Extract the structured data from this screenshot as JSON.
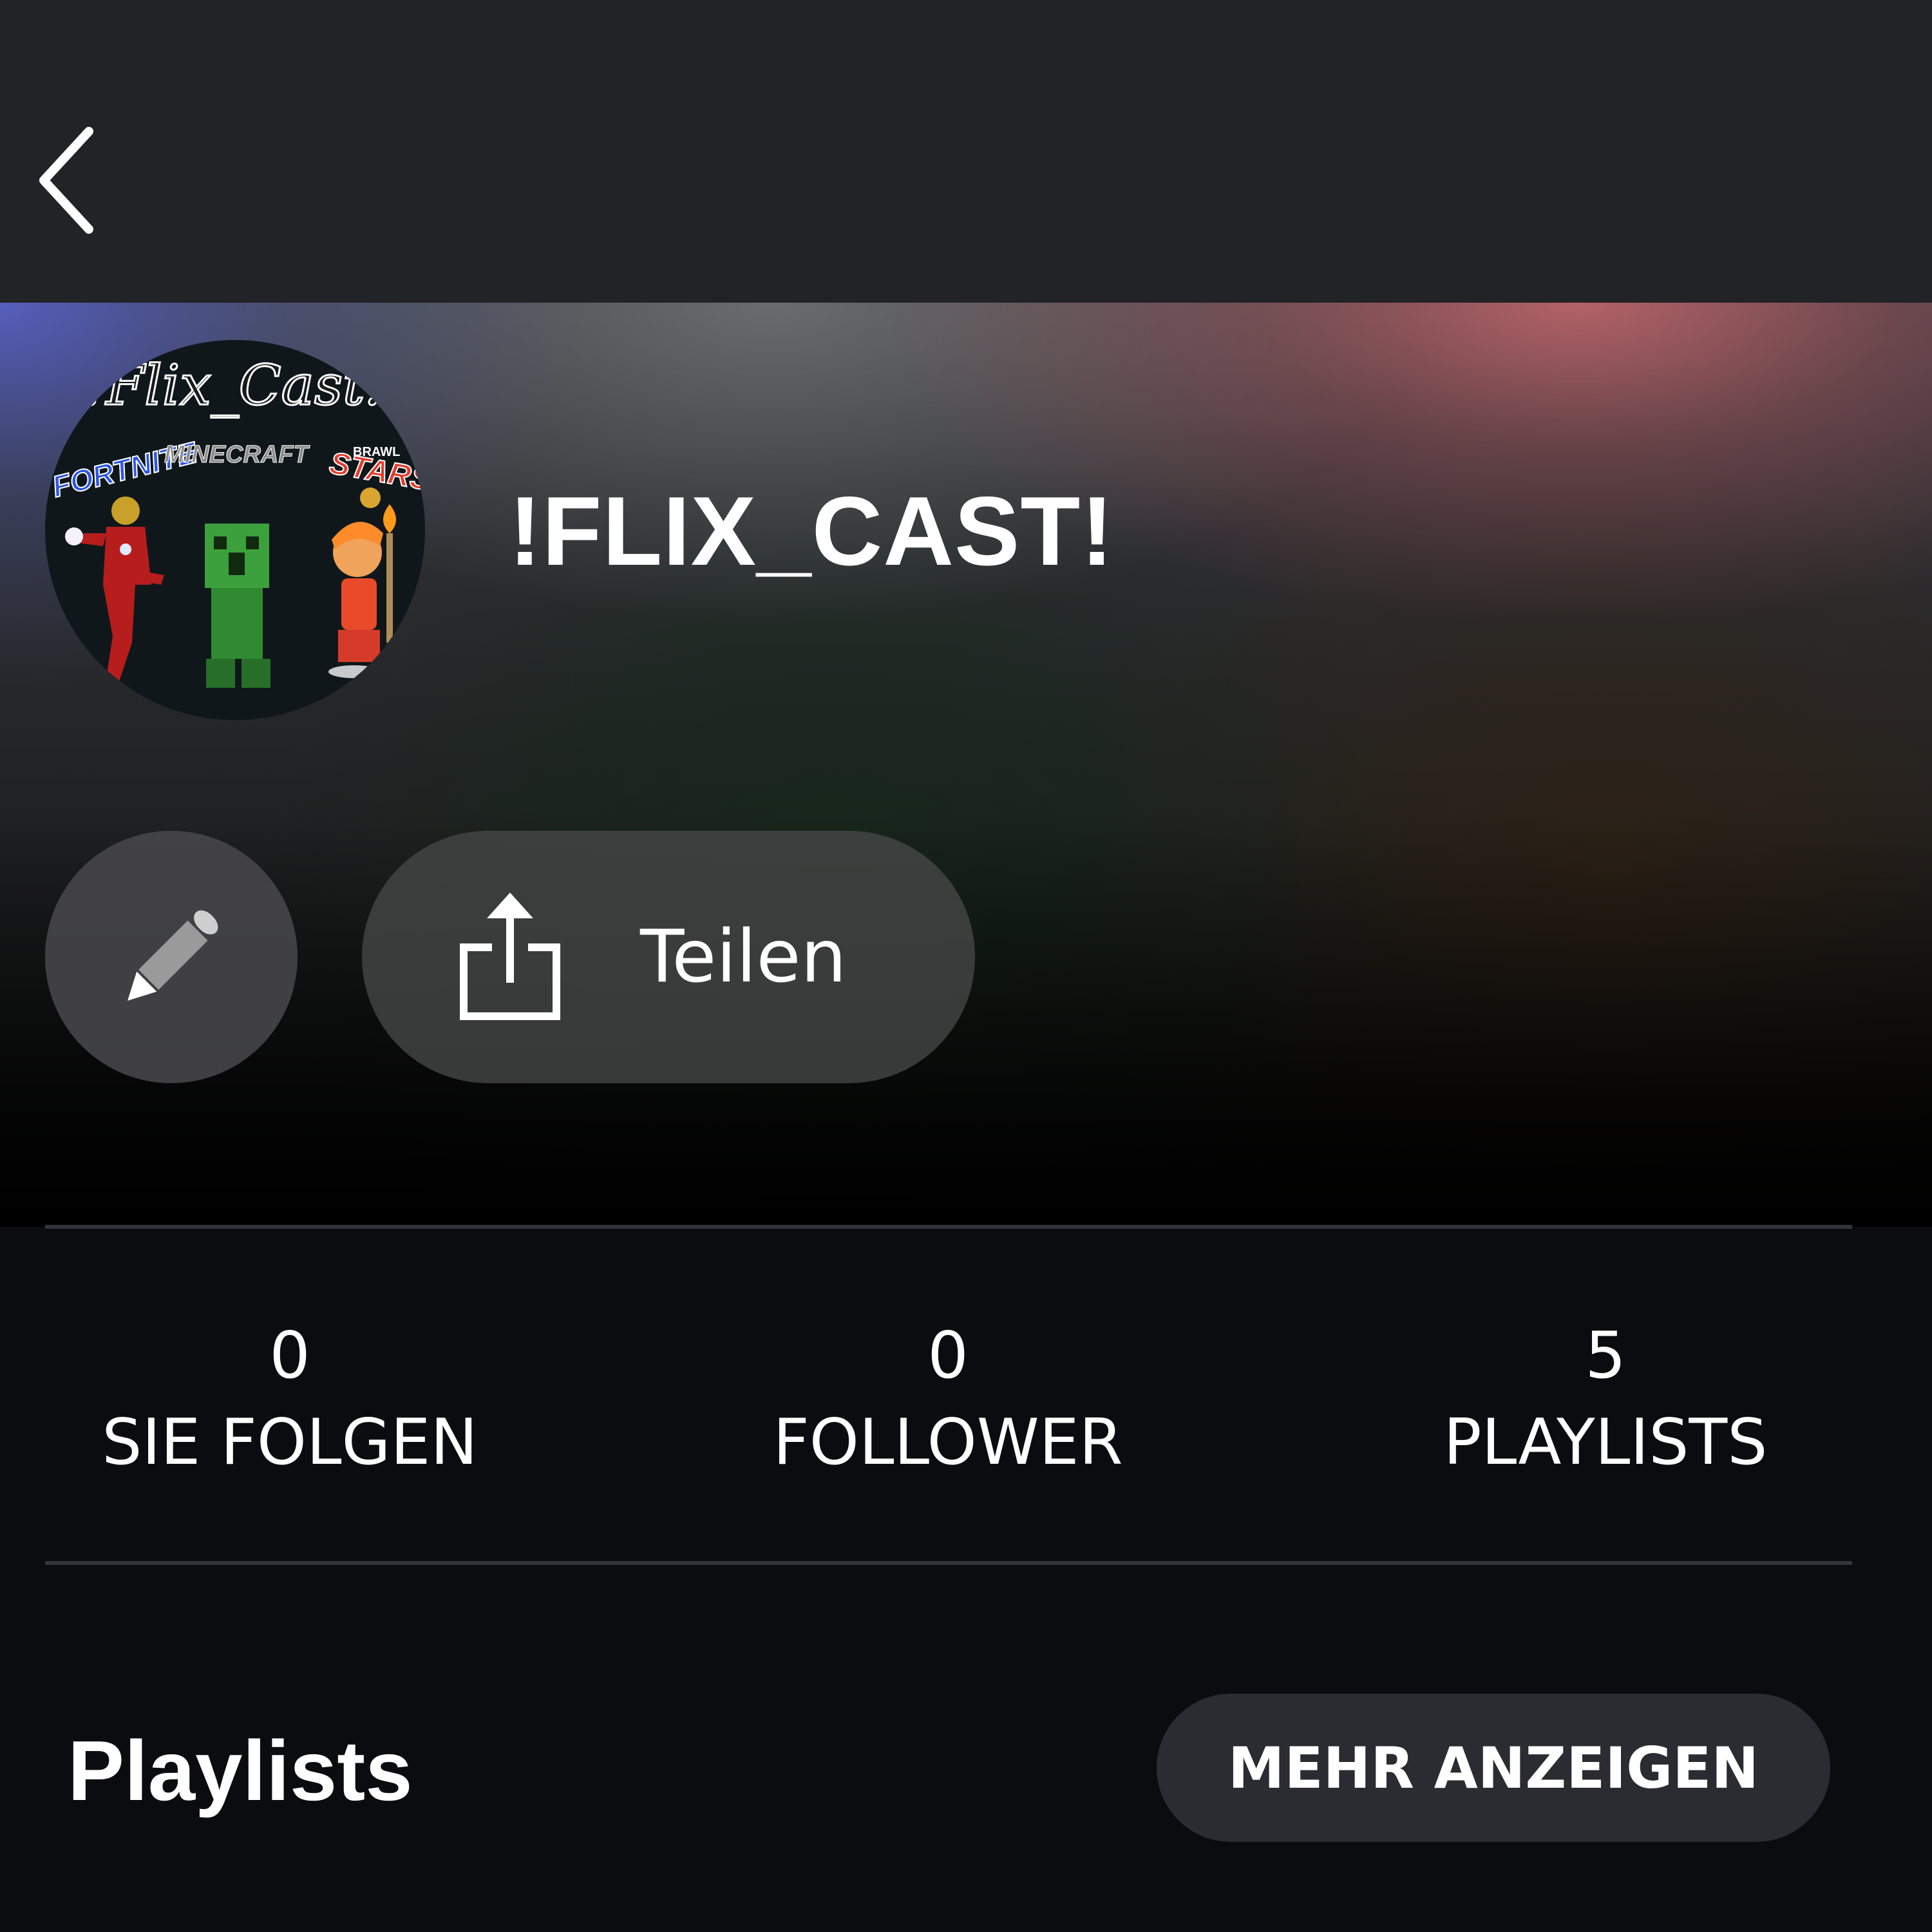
{
  "header": {
    "back_icon": "chevron-left-icon"
  },
  "profile": {
    "name": "!FLIX_CAST!",
    "avatar_texts": [
      "!Flix_Cast!",
      "FORTNITE",
      "MINECRAFT",
      "BRAWL",
      "STARS"
    ]
  },
  "actions": {
    "edit_icon": "pencil-icon",
    "share_icon": "share-icon",
    "share_label": "Teilen"
  },
  "stats": [
    {
      "count": "0",
      "label": "SIE FOLGEN"
    },
    {
      "count": "0",
      "label": "FOLLOWER"
    },
    {
      "count": "5",
      "label": "PLAYLISTS"
    }
  ],
  "playlists": {
    "title": "Playlists",
    "more_label": "MEHR ANZEIGEN"
  },
  "colors": {
    "background": "#0b0c10",
    "topbar": "#222326",
    "button": "#2b2c31",
    "text": "#ffffff"
  }
}
